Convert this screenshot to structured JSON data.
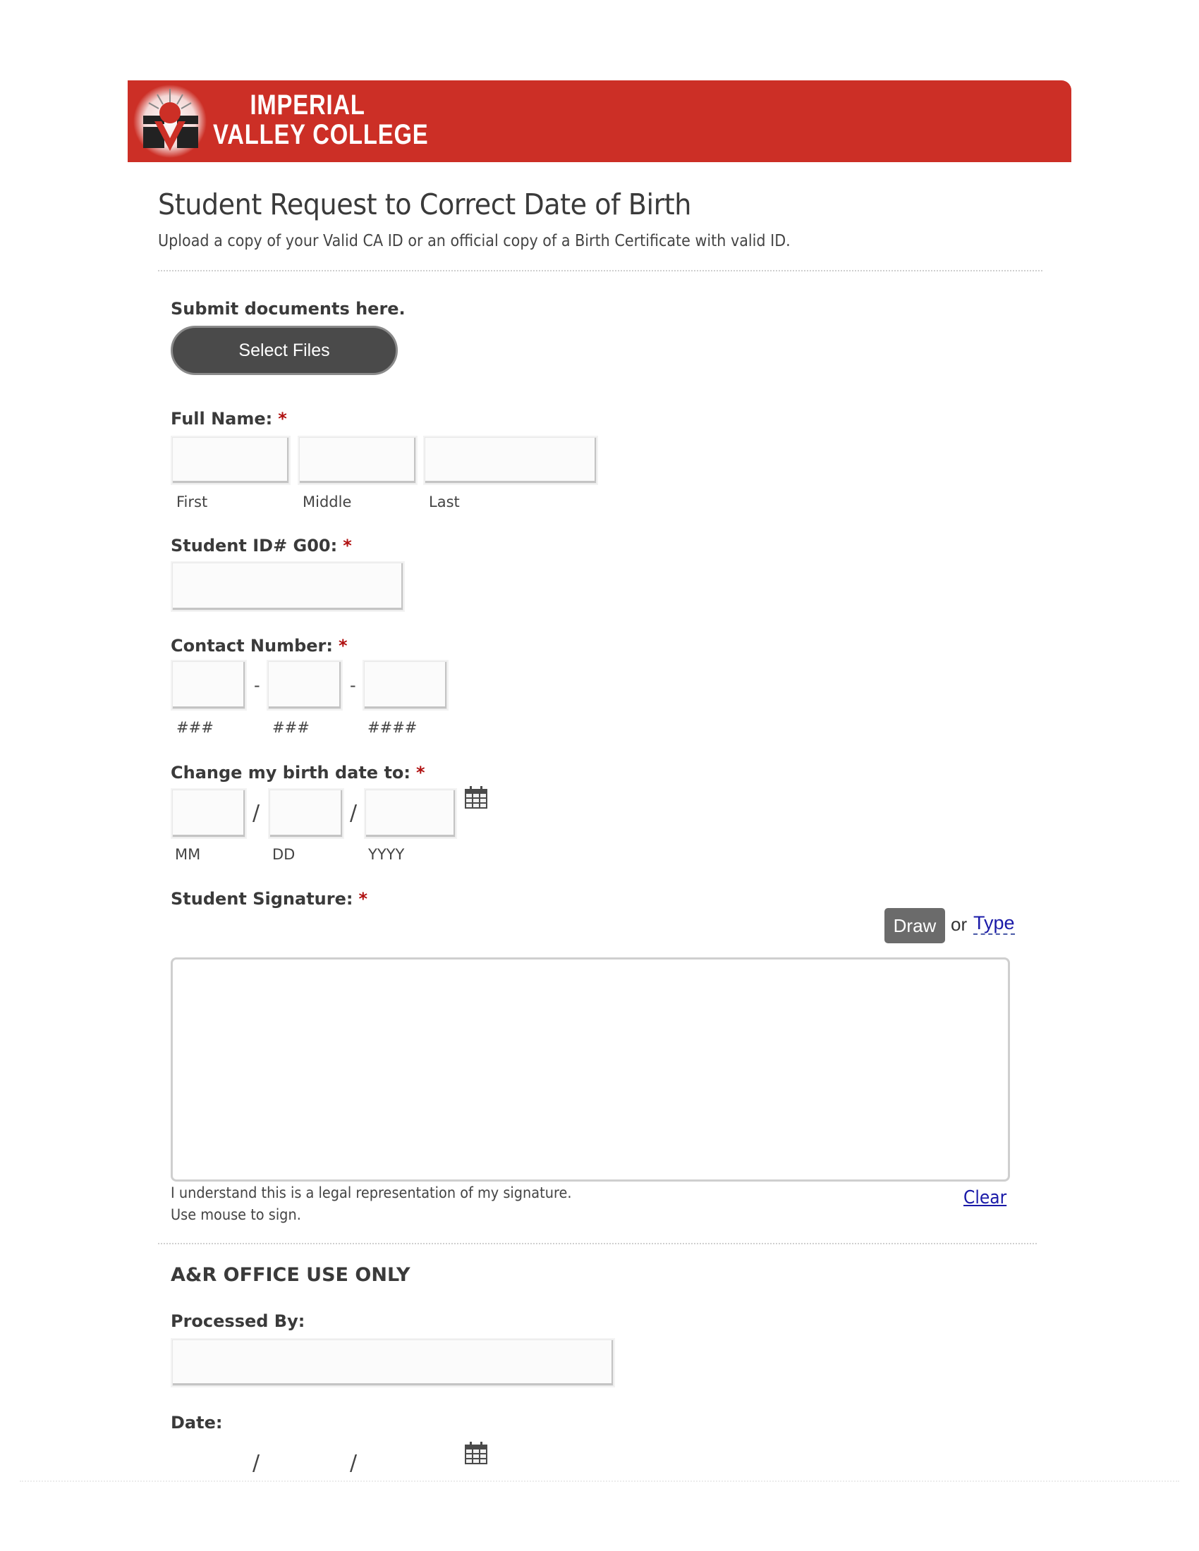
{
  "header": {
    "logo_line1": "IMPERIAL",
    "logo_line2": "VALLEY COLLEGE",
    "brand_color": "#cc2f26"
  },
  "form": {
    "title": "Student Request to Correct Date of Birth",
    "description": "Upload a copy of your Valid CA ID or an official copy of a Birth Certificate with valid ID.",
    "required_marker": "*",
    "upload": {
      "label": "Submit documents here.",
      "button_label": "Select Files"
    },
    "full_name": {
      "label": "Full Name:",
      "fields": [
        {
          "sublabel": "First",
          "value": ""
        },
        {
          "sublabel": "Middle",
          "value": ""
        },
        {
          "sublabel": "Last",
          "value": ""
        }
      ]
    },
    "student_id": {
      "label": "Student ID# G00:",
      "value": ""
    },
    "contact": {
      "label": "Contact Number:",
      "separator": "-",
      "fields": [
        {
          "sublabel": "###",
          "value": ""
        },
        {
          "sublabel": "###",
          "value": ""
        },
        {
          "sublabel": "####",
          "value": ""
        }
      ]
    },
    "birth_date": {
      "label": "Change my birth date to:",
      "separator": "/",
      "icon": "calendar-icon",
      "fields": [
        {
          "sublabel": "MM",
          "value": ""
        },
        {
          "sublabel": "DD",
          "value": ""
        },
        {
          "sublabel": "YYYY",
          "value": ""
        }
      ]
    },
    "signature": {
      "label": "Student Signature:",
      "draw_label": "Draw",
      "or_text": "or",
      "type_label": "Type",
      "legal_line1": "I understand this is a legal representation of my signature.",
      "legal_line2": "Use mouse to sign.",
      "clear_label": "Clear"
    },
    "office": {
      "heading": "A&R OFFICE USE ONLY",
      "processed_by_label": "Processed By:",
      "processed_by_value": "",
      "date_label": "Date:",
      "date_separator": "/",
      "date_icon": "calendar-icon"
    }
  }
}
